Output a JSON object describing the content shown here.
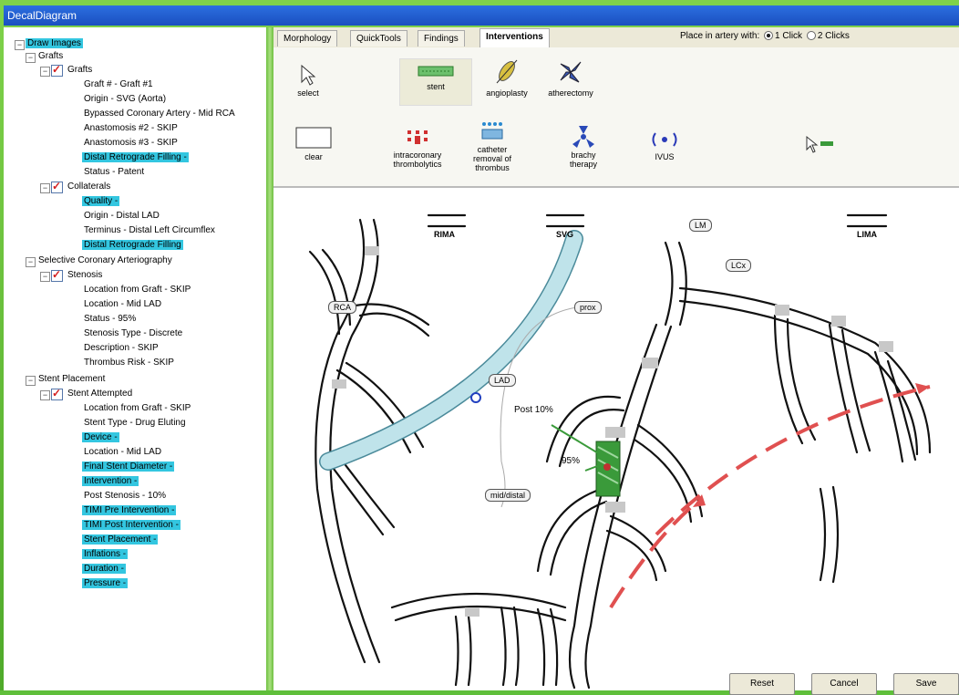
{
  "window": {
    "title": "DecalDiagram"
  },
  "tree": {
    "nodes": [
      {
        "id": "root",
        "label": "Draw Images",
        "hl": true
      },
      {
        "id": "grafts",
        "label": "Grafts"
      },
      {
        "id": "grafts_sub",
        "label": "Grafts"
      },
      {
        "id": "g1",
        "label": "Graft # - Graft #1"
      },
      {
        "id": "g2",
        "label": "Origin - SVG (Aorta)"
      },
      {
        "id": "g3",
        "label": "Bypassed Coronary Artery - Mid RCA"
      },
      {
        "id": "g4",
        "label": "Anastomosis #2 - SKIP"
      },
      {
        "id": "g5",
        "label": "Anastomosis #3 - SKIP"
      },
      {
        "id": "g6",
        "label": "Distal Retrograde Filling -",
        "hl": true
      },
      {
        "id": "g7",
        "label": "Status - Patent"
      },
      {
        "id": "coll",
        "label": "Collaterals"
      },
      {
        "id": "c1",
        "label": "Quality -",
        "hl": true
      },
      {
        "id": "c2",
        "label": "Origin - Distal LAD"
      },
      {
        "id": "c3",
        "label": "Terminus - Distal Left Circumflex"
      },
      {
        "id": "c4",
        "label": "Distal Retrograde Filling",
        "hl": true
      },
      {
        "id": "sca",
        "label": "Selective Coronary Arteriography"
      },
      {
        "id": "sten",
        "label": "Stenosis"
      },
      {
        "id": "s1",
        "label": "Location from Graft - SKIP"
      },
      {
        "id": "s2",
        "label": "Location - Mid LAD"
      },
      {
        "id": "s3",
        "label": "Status - 95%"
      },
      {
        "id": "s4",
        "label": "Stenosis Type - Discrete"
      },
      {
        "id": "s5",
        "label": "Description - SKIP"
      },
      {
        "id": "s6",
        "label": "Thrombus Risk - SKIP"
      },
      {
        "id": "sp",
        "label": "Stent Placement"
      },
      {
        "id": "sa",
        "label": "Stent Attempted"
      },
      {
        "id": "p1",
        "label": "Location from Graft - SKIP"
      },
      {
        "id": "p2",
        "label": "Stent Type - Drug Eluting"
      },
      {
        "id": "p3",
        "label": "Device -",
        "hl": true
      },
      {
        "id": "p4",
        "label": "Location - Mid LAD"
      },
      {
        "id": "p5",
        "label": "Final Stent Diameter -",
        "hl": true
      },
      {
        "id": "p6",
        "label": "Intervention -",
        "hl": true
      },
      {
        "id": "p7",
        "label": "Post Stenosis - 10%"
      },
      {
        "id": "p8",
        "label": "TIMI Pre Intervention -",
        "hl": true
      },
      {
        "id": "p9",
        "label": "TIMI Post Intervention -",
        "hl": true
      },
      {
        "id": "p10",
        "label": "Stent Placement -",
        "hl": true
      },
      {
        "id": "p11",
        "label": "Inflations -",
        "hl": true
      },
      {
        "id": "p12",
        "label": "Duration -",
        "hl": true
      },
      {
        "id": "p13",
        "label": "Pressure -",
        "hl": true
      }
    ]
  },
  "tabs": [
    "Morphology",
    "QuickTools",
    "Findings",
    "Interventions"
  ],
  "active_tab": "Interventions",
  "place_option": {
    "label": "Place in artery with:",
    "opt1": "1 Click",
    "opt2": "2 Clicks"
  },
  "tools": {
    "select": "select",
    "stent": "stent",
    "angioplasty": "angioplasty",
    "atherectomy": "atherectomy",
    "clear": "clear",
    "intracoronary_line1": "intracoronary",
    "intracoronary_line2": "thrombolytics",
    "removal_line1": "catheter",
    "removal_line2": "removal of",
    "removal_line3": "thrombus",
    "brachy_line1": "brachy",
    "brachy_line2": "therapy",
    "ivus": "IVUS"
  },
  "diagram": {
    "labels": {
      "rima": "RIMA",
      "svg": "SVG",
      "lima": "LIMA",
      "lm": "LM",
      "lcx": "LCx",
      "rca": "RCA",
      "prox": "prox",
      "lad": "LAD",
      "mid_distal": "mid/distal",
      "post": "Post 10%",
      "pct95": "95%"
    }
  },
  "buttons": {
    "reset": "Reset",
    "cancel": "Cancel",
    "save": "Save"
  },
  "colors": {
    "highlight": "#33c6e0",
    "graft": "#bfe3ea",
    "collateral": "#e05050",
    "stent": "#3a9a3a"
  }
}
